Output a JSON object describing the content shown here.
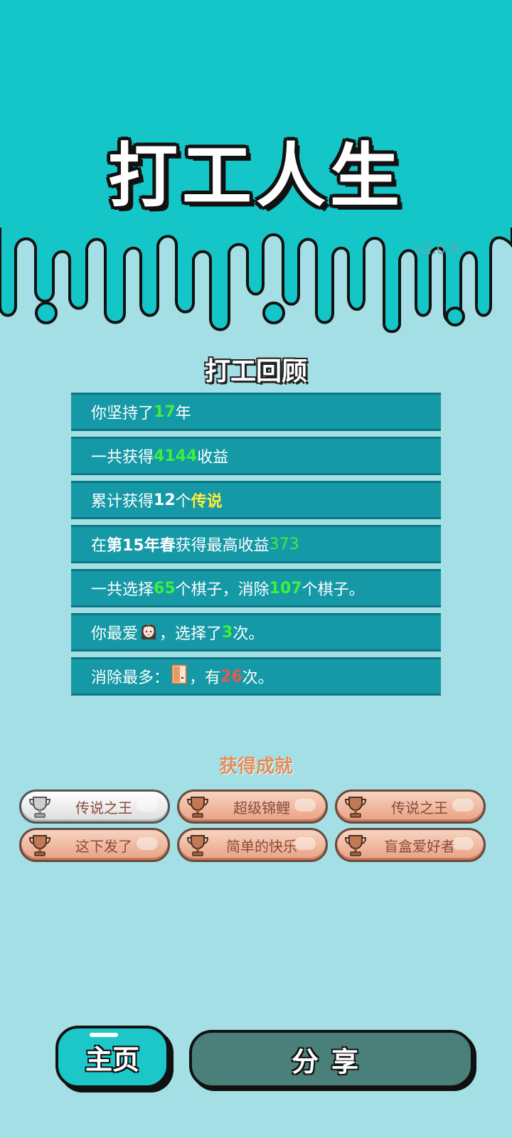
{
  "header": {
    "title": "打工人生",
    "version": "v2.0.9"
  },
  "review": {
    "title": "打工回顾",
    "rows": [
      {
        "pre": "你坚持了",
        "v1": "17",
        "post": "年"
      },
      {
        "pre": "一共获得",
        "v1": "4144",
        "post": "收益"
      },
      {
        "pre": "累计获得",
        "v1": "12",
        "mid": "个",
        "v2": "传说"
      },
      {
        "pre": "在 ",
        "season": "第15年春",
        "mid": " 获得最高收益",
        "v1": "373"
      },
      {
        "pre": "一共选择",
        "v1": "65",
        "mid": "个棋子，消除",
        "v2": "107",
        "post": "个棋子。"
      },
      {
        "pre": "你最爱",
        "icon": "girl-face-icon",
        "mid": "，选择了",
        "v1": "3",
        "post": "次。"
      },
      {
        "pre": "消除最多：",
        "icon": "door-icon",
        "mid": "，有",
        "v1": "26",
        "post": "次。"
      }
    ]
  },
  "achievements": {
    "title": "获得成就",
    "items": [
      {
        "label": "传说之王",
        "tier": "silver"
      },
      {
        "label": "超级锦鲤",
        "tier": "bronze"
      },
      {
        "label": "传说之王",
        "tier": "bronze"
      },
      {
        "label": "这下发了",
        "tier": "bronze"
      },
      {
        "label": "简单的快乐",
        "tier": "bronze"
      },
      {
        "label": "盲盒爱好者",
        "tier": "bronze"
      }
    ]
  },
  "buttons": {
    "home": "主页",
    "share": "分享"
  },
  "colors": {
    "header_bg": "#15c6c8",
    "page_bg": "#a3dfe5",
    "row_bg": "#1599a7",
    "green": "#3ef03a",
    "yellow": "#ffeb3b",
    "red": "#e8584c"
  }
}
